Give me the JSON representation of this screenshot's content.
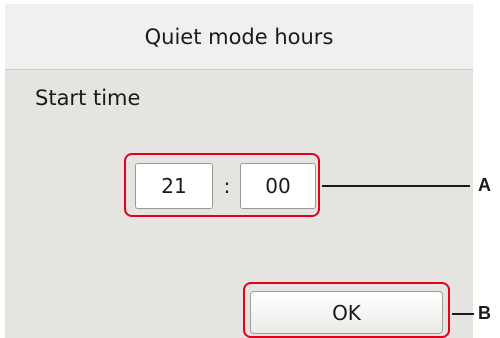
{
  "screen": {
    "title": "Quiet mode hours",
    "start_label": "Start time",
    "time": {
      "hour": "21",
      "separator": ":",
      "minute": "00"
    },
    "ok_label": "OK"
  },
  "callouts": {
    "a": "A",
    "b": "B"
  },
  "colors": {
    "highlight": "#e3001b",
    "panel_background": "#e6e4e1",
    "title_background": "#f1f0ee"
  }
}
